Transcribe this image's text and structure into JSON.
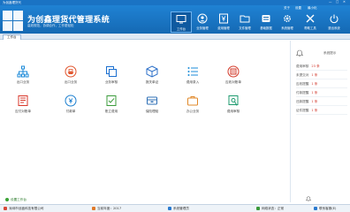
{
  "window": {
    "title": "为创鑫理货代",
    "controls": [
      "—",
      "□",
      "✕"
    ]
  },
  "header": {
    "app_name": "为创鑫理货代管理系统",
    "tagline": "高效规范，协调合作，工作更轻松",
    "links": {
      "about": "关于",
      "settings": "设置",
      "minimize": "最小化"
    },
    "nav": [
      {
        "label": "工作台",
        "icon": "monitor-icon"
      },
      {
        "label": "业务管理",
        "icon": "person-icon"
      },
      {
        "label": "费用管理",
        "icon": "yen-icon"
      },
      {
        "label": "文件管理",
        "icon": "folder-icon"
      },
      {
        "label": "基础数据",
        "icon": "database-icon"
      },
      {
        "label": "系统管理",
        "icon": "gear-icon"
      },
      {
        "label": "帮助工具",
        "icon": "tools-icon"
      },
      {
        "label": "退出系统",
        "icon": "power-icon"
      }
    ]
  },
  "tabs": {
    "active": "工作台"
  },
  "modules": [
    {
      "label": "出口业务",
      "icon": "org-chart-icon",
      "color": "#1b8ad8"
    },
    {
      "label": "出口业务",
      "icon": "ship-icon",
      "color": "#e0542c"
    },
    {
      "label": "业务审核",
      "icon": "copy-icon",
      "color": "#1b6fd0"
    },
    {
      "label": "报关单证",
      "icon": "box-icon",
      "color": "#2b6fc8"
    },
    {
      "label": "费用录入",
      "icon": "list-icon",
      "color": "#1d8dd8"
    },
    {
      "label": "应收对账单",
      "icon": "bill-icon",
      "color": "#d33a2a"
    },
    {
      "label": "应付对账单",
      "icon": "receipt-icon",
      "color": "#d93a2c"
    },
    {
      "label": "付款单",
      "icon": "payment-icon",
      "color": "#1b7fd0"
    },
    {
      "label": "账立费用",
      "icon": "doc-check-icon",
      "color": "#3b9b3b"
    },
    {
      "label": "保险理赔",
      "icon": "file-box-icon",
      "color": "#2e6fb6"
    },
    {
      "label": "办公业务",
      "icon": "bag-icon",
      "color": "#e0892a"
    },
    {
      "label": "费用审核",
      "icon": "audit-icon",
      "color": "#1f9b6f"
    }
  ],
  "sidebar": {
    "title": "系统提示",
    "items": [
      {
        "label": "费用审核",
        "value": "23 条"
      },
      {
        "label": "未提交对",
        "value": "1 条"
      },
      {
        "label": "应收提醒",
        "value": "1 条"
      },
      {
        "label": "付款提醒",
        "value": "1 条"
      },
      {
        "label": "还款提醒",
        "value": "1 条"
      },
      {
        "label": "证件提醒",
        "value": "1 条"
      }
    ]
  },
  "home_link": "设置工作台",
  "status": {
    "company": "深圳市创鑫科技有限公司",
    "year_label": "当前年度：2017",
    "module": "系统管理员",
    "network": "网络状态：正常",
    "contact": "联系客服(E)"
  }
}
